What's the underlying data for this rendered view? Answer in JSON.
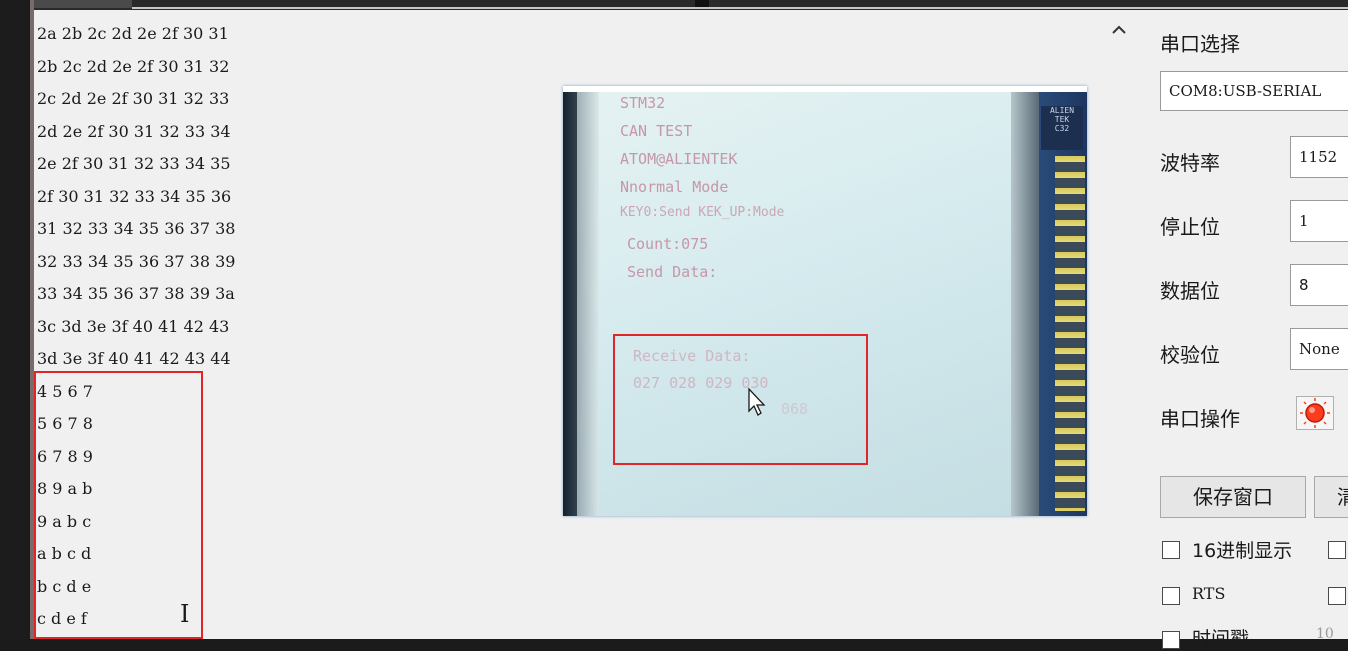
{
  "receive_lines": [
    "2a 2b 2c 2d 2e 2f 30 31",
    "2b 2c 2d 2e 2f 30 31 32",
    "2c 2d 2e 2f 30 31 32 33",
    "2d 2e 2f 30 31 32 33 34",
    "2e 2f 30 31 32 33 34 35",
    "2f 30 31 32 33 34 35 36",
    "31 32 33 34 35 36 37 38",
    "32 33 34 35 36 37 38 39",
    "33 34 35 36 37 38 39 3a",
    "3c 3d 3e 3f 40 41 42 43",
    "3d 3e 3f 40 41 42 43 44",
    "4 5 6 7",
    "5 6 7 8",
    "6 7 8 9",
    "8 9 a b",
    "9 a b c",
    "a b c d",
    "b c d e",
    "c d e f"
  ],
  "scroll_up_icon": "caret-up-icon",
  "text_cursor_icon": "ibeam-cursor-icon",
  "highlight_color": "#e0262a",
  "video": {
    "lcd_lines": [
      "STM32",
      "CAN TEST",
      "ATOM@ALIENTEK",
      "Nnormal Mode",
      "KEY0:Send KEK_UP:Mode",
      "Count:075",
      "Send Data:"
    ],
    "receive_label": "Receive Data:",
    "receive_values": "027 028 029 030",
    "receive_values2": "068",
    "pointer_icon": "mouse-pointer-icon"
  },
  "panel": {
    "port_select_label": "串口选择",
    "port_value": "COM8:USB-SERIAL",
    "baud_label": "波特率",
    "baud_value": "1152",
    "stopbits_label": "停止位",
    "stopbits_value": "1",
    "databits_label": "数据位",
    "databits_value": "8",
    "parity_label": "校验位",
    "parity_value": "None",
    "port_op_label": "串口操作",
    "save_window_button": "保存窗口",
    "clear_button_partial": "清",
    "hex_display_label": "16进制显示",
    "rts_label": "RTS",
    "timestamp_label": "时间戳",
    "timestamp_value": "10"
  }
}
